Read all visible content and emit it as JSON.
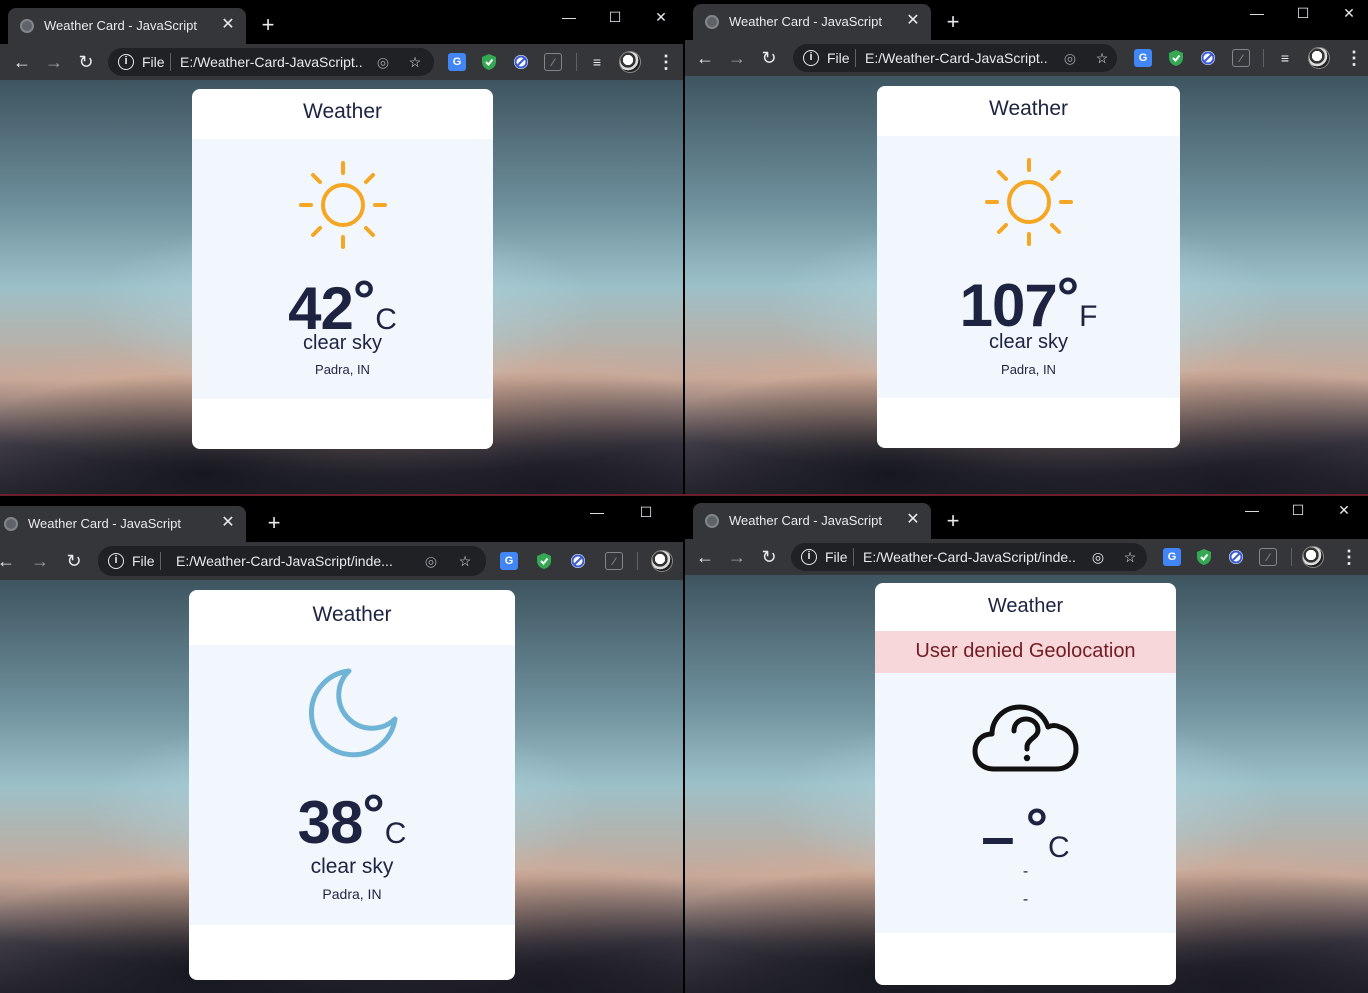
{
  "windows": [
    {
      "tab_title": "Weather Card - JavaScript",
      "url_scheme": "File",
      "url": "E:/Weather-Card-JavaScript...",
      "card": {
        "header": "Weather",
        "icon": "sun-icon",
        "temp": "42",
        "degree": "°",
        "unit": "C",
        "description": "clear sky",
        "location": "Padra, IN"
      }
    },
    {
      "tab_title": "Weather Card - JavaScript",
      "url_scheme": "File",
      "url": "E:/Weather-Card-JavaScript...",
      "card": {
        "header": "Weather",
        "icon": "sun-icon",
        "temp": "107",
        "degree": "°",
        "unit": "F",
        "description": "clear sky",
        "location": "Padra, IN"
      }
    },
    {
      "tab_title": "Weather Card - JavaScript",
      "url_scheme": "File",
      "url": "E:/Weather-Card-JavaScript/inde...",
      "card": {
        "header": "Weather",
        "icon": "moon-icon",
        "temp": "38",
        "degree": "°",
        "unit": "C",
        "description": "clear sky",
        "location": "Padra, IN"
      }
    },
    {
      "tab_title": "Weather Card - JavaScript",
      "url_scheme": "File",
      "url": "E:/Weather-Card-JavaScript/inde...",
      "card": {
        "header": "Weather",
        "error": "User denied Geolocation",
        "icon": "cloud-question-icon",
        "temp": "–",
        "degree": "°",
        "unit": "C",
        "description": "-",
        "location": "-"
      }
    }
  ],
  "icons": {
    "sun_color": "#f5a623",
    "moon_color": "#6fb3d6",
    "text_color": "#1d2340",
    "error_bg": "#f8d7da"
  }
}
